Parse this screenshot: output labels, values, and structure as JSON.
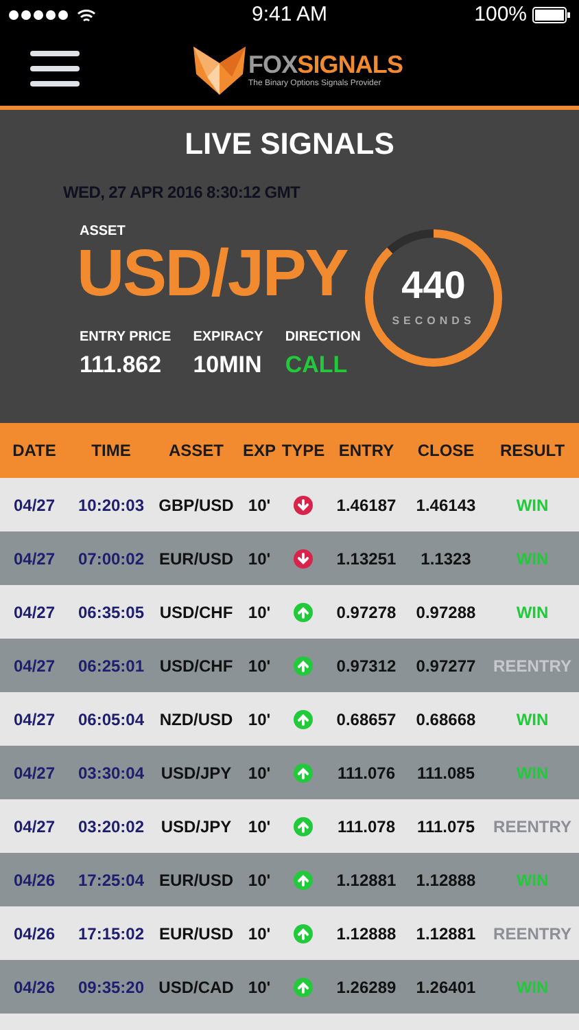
{
  "status_bar": {
    "time": "9:41 AM",
    "battery": "100%"
  },
  "header": {
    "brand_first": "FOX",
    "brand_second": "SIGNALS",
    "tagline": "The Binary Options Signals Provider"
  },
  "live": {
    "title": "LIVE SIGNALS",
    "timestamp": "WED, 27 APR 2016 8:30:12 GMT",
    "asset_label": "ASSET",
    "asset": "USD/JPY",
    "stats": [
      {
        "label": "ENTRY PRICE",
        "value": "111.862",
        "kind": "plain"
      },
      {
        "label": "EXPIRACY",
        "value": "10MIN",
        "kind": "plain"
      },
      {
        "label": "DIRECTION",
        "value": "CALL",
        "kind": "direction"
      }
    ],
    "countdown": {
      "value": "440",
      "unit": "SECONDS",
      "level": 0.88
    }
  },
  "table": {
    "columns": [
      "DATE",
      "TIME",
      "ASSET",
      "EXP",
      "TYPE",
      "ENTRY",
      "CLOSE",
      "RESULT"
    ],
    "rows": [
      {
        "date": "04/27",
        "time": "10:20:03",
        "asset": "GBP/USD",
        "exp": "10'",
        "up": false,
        "entry": "1.46187",
        "close": "1.46143",
        "result": "WIN",
        "win": true
      },
      {
        "date": "04/27",
        "time": "07:00:02",
        "asset": "EUR/USD",
        "exp": "10'",
        "up": false,
        "entry": "1.13251",
        "close": "1.1323",
        "result": "WIN",
        "win": true
      },
      {
        "date": "04/27",
        "time": "06:35:05",
        "asset": "USD/CHF",
        "exp": "10'",
        "up": true,
        "entry": "0.97278",
        "close": "0.97288",
        "result": "WIN",
        "win": true
      },
      {
        "date": "04/27",
        "time": "06:25:01",
        "asset": "USD/CHF",
        "exp": "10'",
        "up": true,
        "entry": "0.97312",
        "close": "0.97277",
        "result": "REENTRY",
        "win": false
      },
      {
        "date": "04/27",
        "time": "06:05:04",
        "asset": "NZD/USD",
        "exp": "10'",
        "up": true,
        "entry": "0.68657",
        "close": "0.68668",
        "result": "WIN",
        "win": true
      },
      {
        "date": "04/27",
        "time": "03:30:04",
        "asset": "USD/JPY",
        "exp": "10'",
        "up": true,
        "entry": "111.076",
        "close": "111.085",
        "result": "WIN",
        "win": true
      },
      {
        "date": "04/27",
        "time": "03:20:02",
        "asset": "USD/JPY",
        "exp": "10'",
        "up": true,
        "entry": "111.078",
        "close": "111.075",
        "result": "REENTRY",
        "win": false
      },
      {
        "date": "04/26",
        "time": "17:25:04",
        "asset": "EUR/USD",
        "exp": "10'",
        "up": true,
        "entry": "1.12881",
        "close": "1.12888",
        "result": "WIN",
        "win": true
      },
      {
        "date": "04/26",
        "time": "17:15:02",
        "asset": "EUR/USD",
        "exp": "10'",
        "up": true,
        "entry": "1.12888",
        "close": "1.12881",
        "result": "REENTRY",
        "win": false
      },
      {
        "date": "04/26",
        "time": "09:35:20",
        "asset": "USD/CAD",
        "exp": "10'",
        "up": true,
        "entry": "1.26289",
        "close": "1.26401",
        "result": "WIN",
        "win": true
      }
    ]
  }
}
